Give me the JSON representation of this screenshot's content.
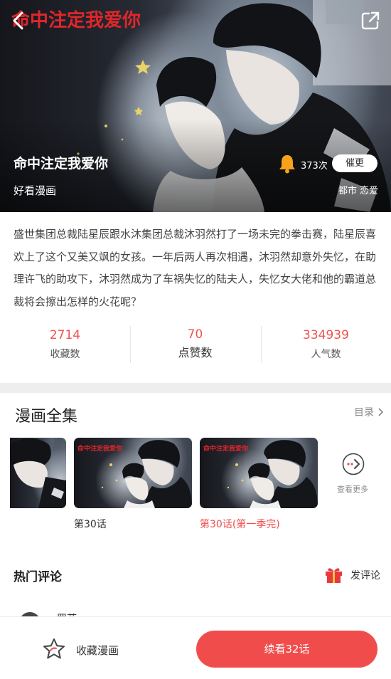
{
  "colors": {
    "accent_red": "#f14c4c",
    "number_red": "#ef5350",
    "bell_orange": "#f7a21b",
    "watermark_red": "#e0262b"
  },
  "hero": {
    "watermark_title": "命中注定我爱你",
    "title": "命中注定我爱你",
    "subtitle": "好看漫画",
    "remind_count": "373次",
    "urge_label": "催更",
    "tags": [
      "都市",
      "恋爱"
    ],
    "back_icon": "back-chevron-icon",
    "share_icon": "share-external-icon",
    "bell_icon": "bell-icon"
  },
  "description": "盛世集团总裁陆星辰跟水沐集团总裁沐羽然打了一场未完的拳击赛，陆星辰喜欢上了这个又美又飒的女孩。一年后两人再次相遇，沐羽然却意外失忆，在助理许飞的助攻下，沐羽然成为了车祸失忆的陆夫人，失忆女大佬和他的霸道总裁将会擦出怎样的火花呢？",
  "stats": {
    "favorites": {
      "value": "2714",
      "label": "收藏数"
    },
    "likes": {
      "value": "70",
      "label": "点赞数"
    },
    "popularity": {
      "value": "334939",
      "label": "人气数"
    }
  },
  "episodes": {
    "section_title": "漫画全集",
    "toc_label": "目录",
    "toc_icon": "chevron-right-icon",
    "items": [
      {
        "caption": "",
        "watermark": ""
      },
      {
        "caption": "第30话",
        "watermark": "命中注定我爱你",
        "current": false
      },
      {
        "caption": "第30话(第一季完)",
        "watermark": "命中注定我爱你",
        "current": true
      }
    ],
    "more_label": "查看更多",
    "more_icon": "more-arrow-circle-icon"
  },
  "comments": {
    "title": "热门评论",
    "post_label": "发评论",
    "gift_icon": "gift-icon",
    "peek_name": "罗菲"
  },
  "bottom_bar": {
    "favorite_label": "收藏漫画",
    "favorite_icon": "star-icon",
    "read_label": "续看32话"
  }
}
